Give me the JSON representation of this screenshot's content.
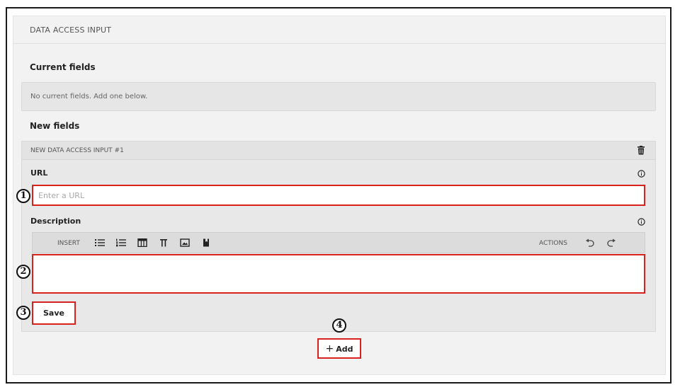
{
  "panel": {
    "title": "DATA ACCESS INPUT"
  },
  "current": {
    "heading": "Current fields",
    "empty_text": "No current fields. Add one below."
  },
  "new_fields": {
    "heading": "New fields",
    "card_title": "NEW DATA ACCESS INPUT #1",
    "url": {
      "label": "URL",
      "placeholder": "Enter a URL",
      "value": ""
    },
    "description": {
      "label": "Description",
      "value": ""
    },
    "toolbar": {
      "insert_label": "INSERT",
      "actions_label": "ACTIONS",
      "insert_icons": [
        "bullet-list-icon",
        "numbered-list-icon",
        "table-icon",
        "pi-icon",
        "image-icon",
        "bookmark-icon"
      ],
      "action_icons": [
        "undo-icon",
        "redo-icon"
      ]
    },
    "save_label": "Save"
  },
  "add_label": "Add",
  "callouts": [
    "1",
    "2",
    "3",
    "4"
  ],
  "colors": {
    "highlight": "#d9221f",
    "panel_bg": "#f2f2f2",
    "card_bg": "#e8e8e8"
  }
}
